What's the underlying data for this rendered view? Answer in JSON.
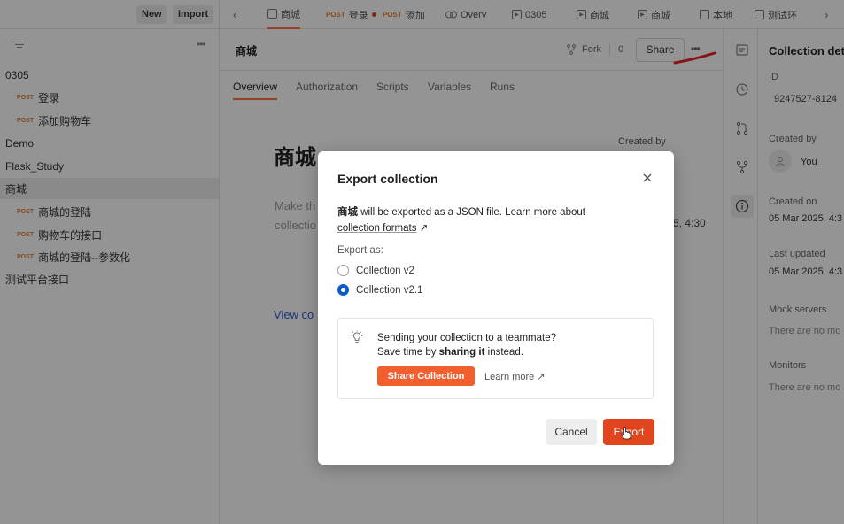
{
  "topbar": {
    "new_label": "New",
    "import_label": "Import",
    "tabs": [
      {
        "label": "商城",
        "type": "collection",
        "active": true
      },
      {
        "method": "POST",
        "label": "登录",
        "unsaved": true
      },
      {
        "method": "POST",
        "label": "添加"
      },
      {
        "label": "Overv",
        "type": "environment"
      },
      {
        "label": "0305",
        "type": "runner"
      },
      {
        "label": "商城",
        "type": "runner"
      },
      {
        "label": "商城",
        "type": "runner"
      },
      {
        "label": "本地",
        "type": "doc"
      },
      {
        "label": "测试环",
        "type": "doc"
      }
    ]
  },
  "sidebar": {
    "items": [
      {
        "type": "folder",
        "label": "0305"
      },
      {
        "type": "request",
        "method": "POST",
        "label": "登录"
      },
      {
        "type": "request",
        "method": "POST",
        "label": "添加购物车"
      },
      {
        "type": "folder",
        "label": "Demo"
      },
      {
        "type": "folder",
        "label": "Flask_Study"
      },
      {
        "type": "folder",
        "label": "商城",
        "selected": true
      },
      {
        "type": "request",
        "method": "POST",
        "label": "商城的登陆"
      },
      {
        "type": "request",
        "method": "POST",
        "label": "购物车的接口"
      },
      {
        "type": "request",
        "method": "POST",
        "label": "商城的登陆--参数化"
      },
      {
        "type": "folder",
        "label": "测试平台接口"
      }
    ]
  },
  "main": {
    "collection_name": "商城",
    "fork_label": "Fork",
    "fork_count": "0",
    "share_label": "Share",
    "tabs": [
      "Overview",
      "Authorization",
      "Scripts",
      "Variables",
      "Runs"
    ],
    "active_tab": "Overview",
    "overview_title": "商城",
    "description_placeholder_line1": "Make th",
    "description_placeholder_line2": "collectio",
    "created_by_label": "Created by",
    "time_fragment": "5, 4:30",
    "view_link": "View co"
  },
  "details": {
    "title": "Collection det",
    "id_label": "ID",
    "id_value": "9247527-8124",
    "created_by_label": "Created by",
    "created_by_value": "You",
    "created_on_label": "Created on",
    "created_on_value": "05 Mar 2025, 4:3",
    "last_updated_label": "Last updated",
    "last_updated_value": "05 Mar 2025, 4:3",
    "mock_servers_label": "Mock servers",
    "mock_servers_value": "There are no mo",
    "monitors_label": "Monitors",
    "monitors_value": "There are no mo"
  },
  "modal": {
    "title": "Export collection",
    "desc_name": "商城",
    "desc_text": " will be exported as a JSON file. Learn more about",
    "desc_link": "collection formats",
    "desc_link_arrow": "↗",
    "export_as_label": "Export as:",
    "options": [
      {
        "label": "Collection v2",
        "checked": false
      },
      {
        "label": "Collection v2.1",
        "checked": true
      }
    ],
    "tip_line1": "Sending your collection to a teammate?",
    "tip_line2_pre": "Save time by ",
    "tip_line2_bold": "sharing it",
    "tip_line2_post": " instead.",
    "share_collection_label": "Share Collection",
    "learn_more_label": "Learn more",
    "learn_more_arrow": "↗",
    "cancel_label": "Cancel",
    "export_label": "Export"
  },
  "colors": {
    "accent": "#ff6c37",
    "export_button": "#e0451e",
    "radio_selected": "#0b5cc9",
    "post_method": "#e0803a",
    "annotation": "#e8202a"
  }
}
